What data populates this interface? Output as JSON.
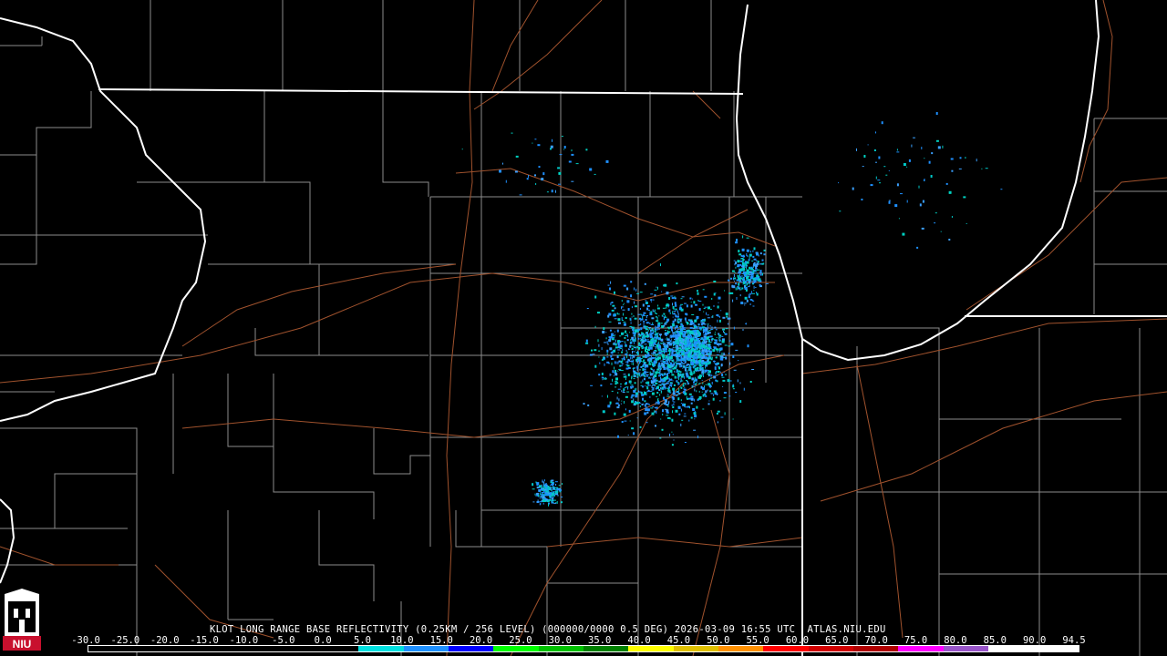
{
  "product": {
    "caption": "KLOT LONG RANGE BASE REFLECTIVITY (0.25KM / 256 LEVEL) (000000/0000 0.5 DEG) 2026-03-09 16:55 UTC  ATLAS.NIU.EDU"
  },
  "logo": {
    "text": "NIU",
    "icon": "niu-tower-logo",
    "color": "#c8102e"
  },
  "colors": {
    "background": "#000000",
    "state_lines": "#ffffff",
    "county_lines": "#8c8c8c",
    "roads": "#a0522d",
    "echo_primary": "#1e90ff",
    "echo_secondary": "#00c8c8"
  },
  "scale": {
    "labels": [
      "-30.0",
      "-25.0",
      "-20.0",
      "-15.0",
      "-10.0",
      "-5.0",
      "0.0",
      "5.0",
      "10.0",
      "15.0",
      "20.0",
      "25.0",
      "30.0",
      "35.0",
      "40.0",
      "45.0",
      "50.0",
      "55.0",
      "60.0",
      "65.0",
      "70.0",
      "75.0",
      "80.0",
      "85.0",
      "90.0",
      "94.5"
    ],
    "colors": [
      "#000000",
      "#000000",
      "#000000",
      "#000000",
      "#000000",
      "#000000",
      "#00e0e0",
      "#1e90ff",
      "#0000ff",
      "#00ff00",
      "#00c000",
      "#008000",
      "#ffff00",
      "#e0c000",
      "#ff9000",
      "#ff0000",
      "#d00000",
      "#b00000",
      "#ff00ff",
      "#9955c9",
      "#ffffff",
      "#ffffff"
    ]
  }
}
